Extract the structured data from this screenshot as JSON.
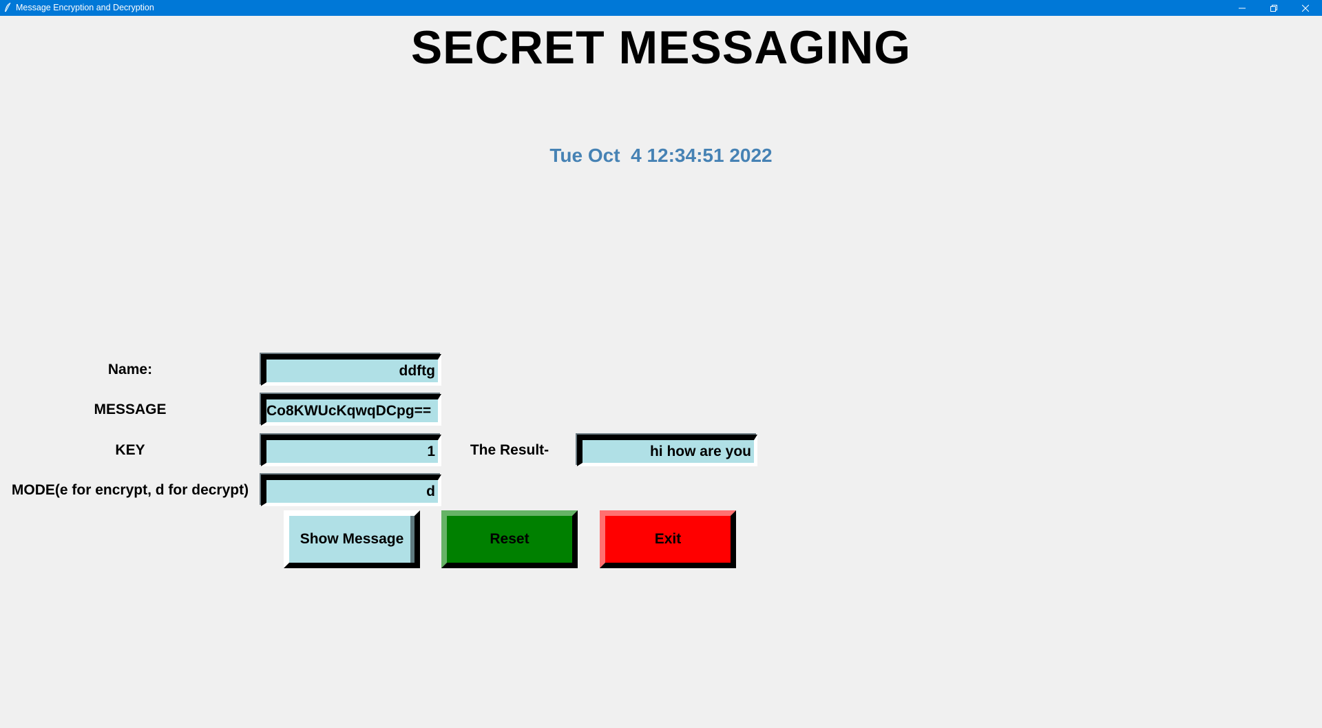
{
  "window": {
    "title": "Message Encryption and Decryption"
  },
  "heading": "SECRET MESSAGING",
  "clock": "Tue Oct  4 12:34:51 2022",
  "form": {
    "name_label": "Name:",
    "name_value": "ddftg",
    "message_label": "MESSAGE",
    "message_value": "Co8KWUcKqwqDCpg==",
    "key_label": "KEY",
    "key_value": "1",
    "mode_label": "MODE(e for encrypt, d for decrypt)",
    "mode_value": "d",
    "result_label": "The Result-",
    "result_value": "hi how are you"
  },
  "buttons": {
    "show": "Show Message",
    "reset": "Reset",
    "exit": "Exit"
  },
  "colors": {
    "titlebar": "#0078d7",
    "entry_bg": "#b0e0e6",
    "clock": "#4682b4",
    "reset": "#008000",
    "exit": "#ff0000"
  },
  "icons": {
    "app": "feather-icon",
    "minimize": "minimize-icon",
    "maximize": "restore-icon",
    "close": "close-icon"
  }
}
